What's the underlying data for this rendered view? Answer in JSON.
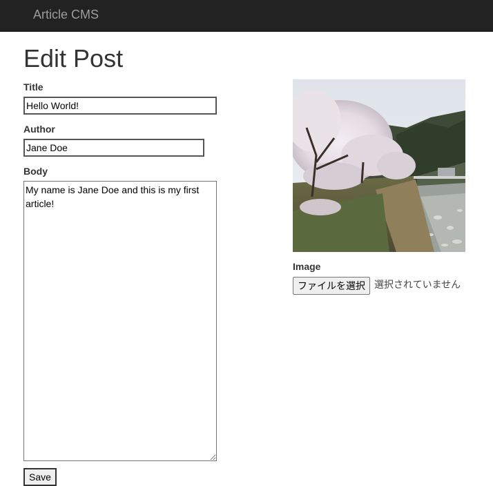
{
  "navbar": {
    "brand": "Article CMS"
  },
  "page": {
    "title": "Edit Post"
  },
  "form": {
    "title_label": "Title",
    "title_value": "Hello World!",
    "author_label": "Author",
    "author_value": "Jane Doe",
    "body_label": "Body",
    "body_value": "My name is Jane Doe and this is my first article!",
    "save_label": "Save"
  },
  "image": {
    "label": "Image",
    "choose_file_label": "ファイルを選択",
    "file_status": "選択されていません"
  },
  "colors": {
    "navbar_bg": "#222222",
    "brand_text": "#9d9d9d",
    "text": "#333333"
  }
}
